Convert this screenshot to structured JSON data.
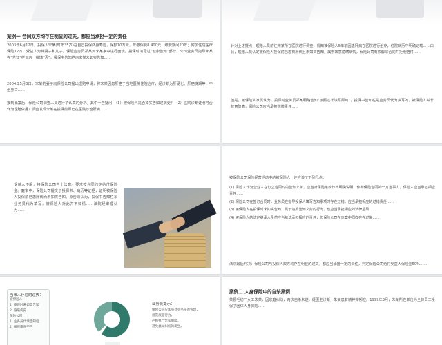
{
  "slide1": {
    "title": "案例一  合同双方均存在明显的过失，都应当承担一定的责任",
    "p1": "2003年6月12日，投保人宋某(时年35岁)在自己投保终身寿险，保额10万元，年缴保费8 400元，缴费期间20年；附加住院医疗保险12万，受益人为其妻子和儿子。保险业务员郑某到宋某家中进行面谈。投保时填写过“健康告知”部分，公司业务员指导宋某在“告知”栏目内一律填“否”，投保书告知栏内宋某未如实告知……",
    "p2": "2004年5月3日，宋某的妻子向保险公司提出理赔申请，称宋某因患肝癌于当地医院住院治疗，经诊断为肝硬化、肝癌晚期等，不治身亡……",
    "p3": "接到此案后，保险公司调查人员进行了认真的分析。其中一些疑问：（1）被保险人是否如实告知过病史？（2）医院诊断证明可否作为理赔依据？调查发现宋某在投保前即已在医院诊治肝病……"
  },
  "slide2": {
    "p1": "针对上述疑点，理赔人员前往宋某所在医院进行调查，得知被保险人5年前因患肝病在医院进行治疗，住院病历中明确记载……由此，理赔人员认定被保险人投保前已患有肝病且未如实告知，属于故意隐瞒病情，保险公司有权解除合同并拒绝赔付……",
    "p2": "但是，被保险人家属认为，投保时业务员郑某明确告知“按照这样填写即可”，投保书告知栏是业务员代为填写的，被保险人并非故意隐瞒，保险公司应当承担赔偿责任……"
  },
  "slide3": {
    "p1": "受益人不服，将保险公司告上法庭。要求按合同约定给付保险金。庭审中，保险公司提交了投保书、病历等证据，证明被保险人投保前已患肝病而未如实告知。原告则认为，投保书告知栏系业务员代为填写，被保险人对此并不知情……法院经审理认为……"
  },
  "slide4": {
    "intro": "被保险公司保险经营活动中的被保险人，还应该了下列几点：",
    "items": [
      "(1) 保险人作为营业人在订立合同时的告知义务，应当对保险条款作出明确说明，作为保险合同的一方当事人，保险人应当承担相应责任……",
      "(2) 保险公司在签订合同时，业务员在指导投保人填写告知事项时存在过错，应当承担相应的过错责任……",
      "(3) 被保险人在投保时未如实告知，属于违反告知义务的行为，也应当承担相应的法律后果……",
      "(4) 被保险人的法定继承人虽然应当依法承担相应的责任，但保险公司在本案中同样存在过失……"
    ],
    "conclusion": "法院最后判决：保险公司与投保人双方均存在明显的过失，都应当承担一定的责任，判定保险公司给付受益人保险金50%……"
  },
  "slide5": {
    "box_title": "当事人存在的过失：",
    "box_lines": [
      "被保险人：",
      "1. 投保时未如实告知",
      "2. 隐瞒病史",
      "保险公司：",
      "1. 业务员代填告知栏",
      "2. 核保审查不严"
    ],
    "right_title": "业务员提示：",
    "right_lines": [
      "保险公司应加强对业务员的管理，",
      "规范展业行为，",
      "严格执行告知制度，",
      "避免类似纠纷的发生。"
    ]
  },
  "slide6": {
    "title": "案例二  人身保险中的自杀案例",
    "p1": "某县毛纺厂女工朱某，因家庭纠纷，两次自杀未遂，经医生诊断，朱某患有精神抑郁症。1999年3月，朱某所在单位为全体员工投保了团体人身保险……"
  }
}
